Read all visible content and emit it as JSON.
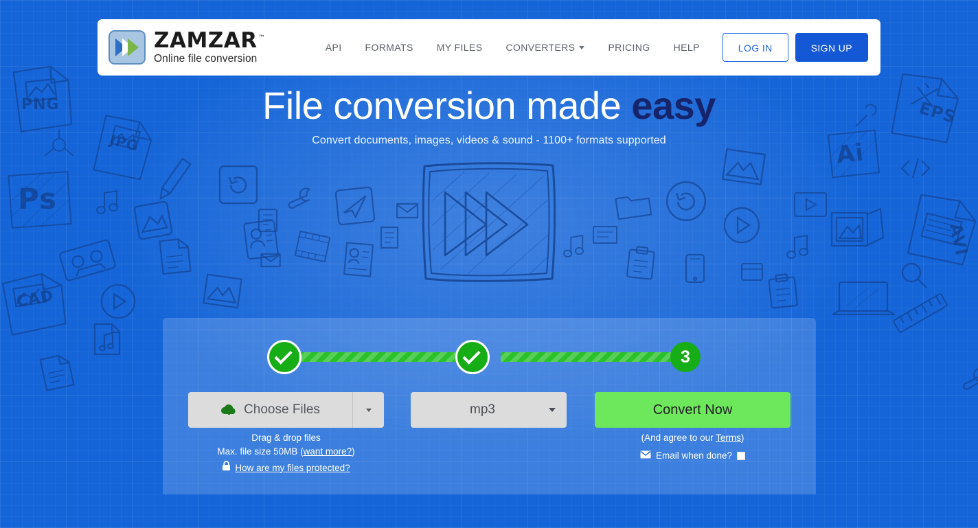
{
  "brand": {
    "name": "ZAMZAR",
    "tm": "™",
    "tagline": "Online file conversion"
  },
  "nav": {
    "items": [
      {
        "label": "API",
        "has_caret": false
      },
      {
        "label": "FORMATS",
        "has_caret": false
      },
      {
        "label": "MY FILES",
        "has_caret": false
      },
      {
        "label": "CONVERTERS",
        "has_caret": true
      },
      {
        "label": "PRICING",
        "has_caret": false
      },
      {
        "label": "HELP",
        "has_caret": false
      }
    ],
    "login_label": "LOG IN",
    "signup_label": "SIGN UP"
  },
  "hero": {
    "title_plain": "File conversion made ",
    "title_accent": "easy",
    "subtitle": "Convert documents, images, videos & sound - 1100+ formats supported"
  },
  "steps": {
    "step1_state": "complete",
    "step2_state": "complete",
    "step3_number": "3"
  },
  "controls": {
    "choose_files_label": "Choose Files",
    "choose_files_icon": "cloud-upload-icon",
    "format_value": "mp3",
    "convert_label": "Convert Now"
  },
  "notes": {
    "drag_drop": "Drag & drop files",
    "max_size_prefix": "Max. file size 50MB (",
    "max_size_link": "want more?",
    "max_size_suffix": ")",
    "protected_link": "How are my files protected?",
    "lock_icon": "lock-icon",
    "agree_prefix": "(And agree to our ",
    "agree_link": "Terms",
    "agree_suffix": ")",
    "email_label": "Email when done?",
    "email_icon": "envelope-icon",
    "email_checked": false
  },
  "colors": {
    "page_blue": "#1565d8",
    "brand_blue": "#1558d6",
    "link_blue": "#1a62dd",
    "step_green": "#17ad17",
    "bar_green": "#2ac12a",
    "convert_green": "#6de85c",
    "title_accent": "#15246b"
  },
  "background": {
    "doodle_labels": [
      "PNG",
      "JPG",
      "Ps",
      "CAD",
      "EPS",
      "Ai",
      "AVI"
    ],
    "sketch": "three-chevrons-in-square"
  }
}
